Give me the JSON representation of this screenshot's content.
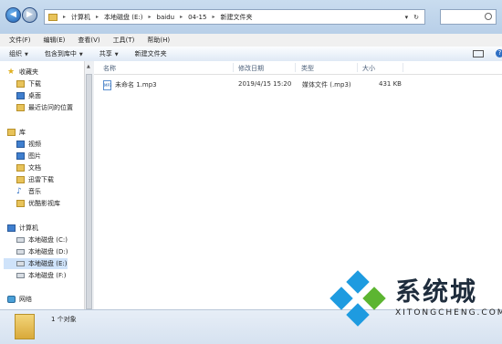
{
  "address": {
    "crumbs": [
      "计算机",
      "本地磁盘 (E:)",
      "baidu",
      "04-15",
      "新建文件夹"
    ]
  },
  "menu": [
    "文件(F)",
    "编辑(E)",
    "查看(V)",
    "工具(T)",
    "帮助(H)"
  ],
  "toolbar": {
    "organize": "组织",
    "include_library": "包含到库中",
    "share": "共享",
    "new_folder": "新建文件夹"
  },
  "sidebar": {
    "favorites": "收藏夹",
    "fav_items": [
      "下载",
      "桌面",
      "最近访问的位置"
    ],
    "library": "库",
    "lib_items": [
      "视频",
      "图片",
      "文档",
      "迅雷下载",
      "音乐",
      "优酷影视库"
    ],
    "computer": "计算机",
    "drives": [
      "本地磁盘 (C:)",
      "本地磁盘 (D:)",
      "本地磁盘 (E:)",
      "本地磁盘 (F:)"
    ],
    "network": "网络"
  },
  "columns": {
    "name": "名称",
    "modified": "修改日期",
    "type": "类型",
    "size": "大小"
  },
  "files": [
    {
      "name": "未命名 1.mp3",
      "modified": "2019/4/15 15:20",
      "type": "媒体文件 (.mp3)",
      "size": "431 KB"
    }
  ],
  "status": {
    "count": "1 个对象"
  },
  "watermark": {
    "title": "系统城",
    "subtitle": "XITONGCHENG.COM"
  },
  "colors": {
    "accent": "#2f6fc4",
    "watermark_blue": "#1e9be0",
    "watermark_green": "#5cb531"
  }
}
